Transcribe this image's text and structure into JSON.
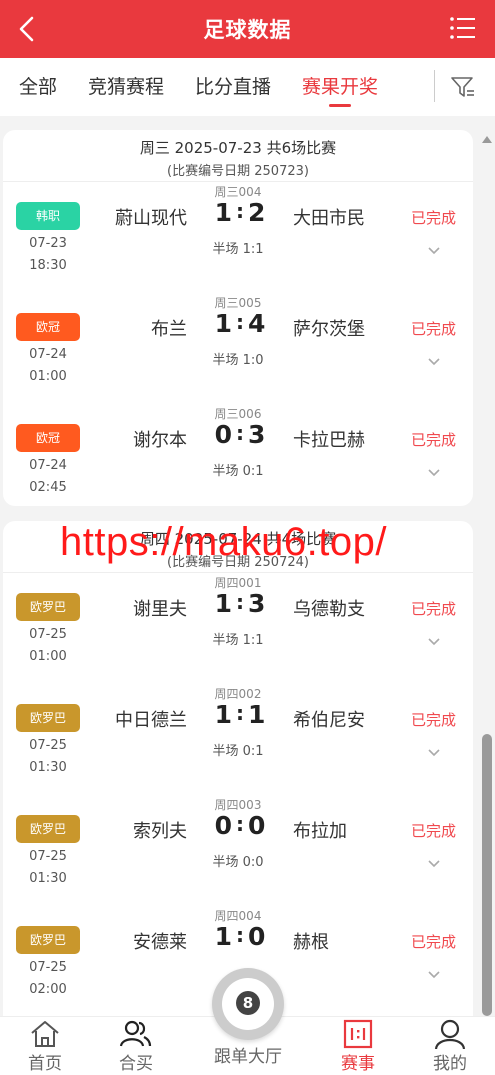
{
  "header": {
    "title": "足球数据"
  },
  "tabs": [
    {
      "label": "全部",
      "active": false
    },
    {
      "label": "竞猜赛程",
      "active": false
    },
    {
      "label": "比分直播",
      "active": false
    },
    {
      "label": "赛果开奖",
      "active": true
    }
  ],
  "groups": [
    {
      "title": "周三 2025-07-23 共6场比赛",
      "subtitle": "(比赛编号日期 250723)",
      "matches": [
        {
          "code": "周三004",
          "league": "韩职",
          "league_color": "#2ad3a4",
          "date": "07-23",
          "time": "18:30",
          "home": "蔚山现代",
          "home_score": "1",
          "away_score": "2",
          "away": "大田市民",
          "half": "半场 1:1",
          "status": "已完成"
        },
        {
          "code": "周三005",
          "league": "欧冠",
          "league_color": "#ff5a1f",
          "date": "07-24",
          "time": "01:00",
          "home": "布兰",
          "home_score": "1",
          "away_score": "4",
          "away": "萨尔茨堡",
          "half": "半场 1:0",
          "status": "已完成"
        },
        {
          "code": "周三006",
          "league": "欧冠",
          "league_color": "#ff5a1f",
          "date": "07-24",
          "time": "02:45",
          "home": "谢尔本",
          "home_score": "0",
          "away_score": "3",
          "away": "卡拉巴赫",
          "half": "半场 0:1",
          "status": "已完成"
        }
      ]
    },
    {
      "title": "周四 2025-07-24 共4场比赛",
      "subtitle": "(比赛编号日期 250724)",
      "matches": [
        {
          "code": "周四001",
          "league": "欧罗巴",
          "league_color": "#c9972c",
          "date": "07-25",
          "time": "01:00",
          "home": "谢里夫",
          "home_score": "1",
          "away_score": "3",
          "away": "乌德勒支",
          "half": "半场 1:1",
          "status": "已完成"
        },
        {
          "code": "周四002",
          "league": "欧罗巴",
          "league_color": "#c9972c",
          "date": "07-25",
          "time": "01:30",
          "home": "中日德兰",
          "home_score": "1",
          "away_score": "1",
          "away": "希伯尼安",
          "half": "半场 0:1",
          "status": "已完成"
        },
        {
          "code": "周四003",
          "league": "欧罗巴",
          "league_color": "#c9972c",
          "date": "07-25",
          "time": "01:30",
          "home": "索列夫",
          "home_score": "0",
          "away_score": "0",
          "away": "布拉加",
          "half": "半场 0:0",
          "status": "已完成"
        },
        {
          "code": "周四004",
          "league": "欧罗巴",
          "league_color": "#c9972c",
          "date": "07-25",
          "time": "02:00",
          "home": "安德莱",
          "home_score": "1",
          "away_score": "0",
          "away": "赫根",
          "half": "",
          "status": "已完成"
        }
      ]
    }
  ],
  "score_separator": ":",
  "watermark": "https://maku6.top/",
  "bottom_nav": {
    "home": "首页",
    "group_buy": "合买",
    "follow": "跟单大厅",
    "follow_ball": "8",
    "events": "赛事",
    "mine": "我的"
  },
  "colors": {
    "brand": "#e9393e",
    "status": "#f0494e",
    "badge_kor": "#2ad3a4",
    "badge_ucl": "#ff5a1f",
    "badge_uel": "#c9972c"
  }
}
